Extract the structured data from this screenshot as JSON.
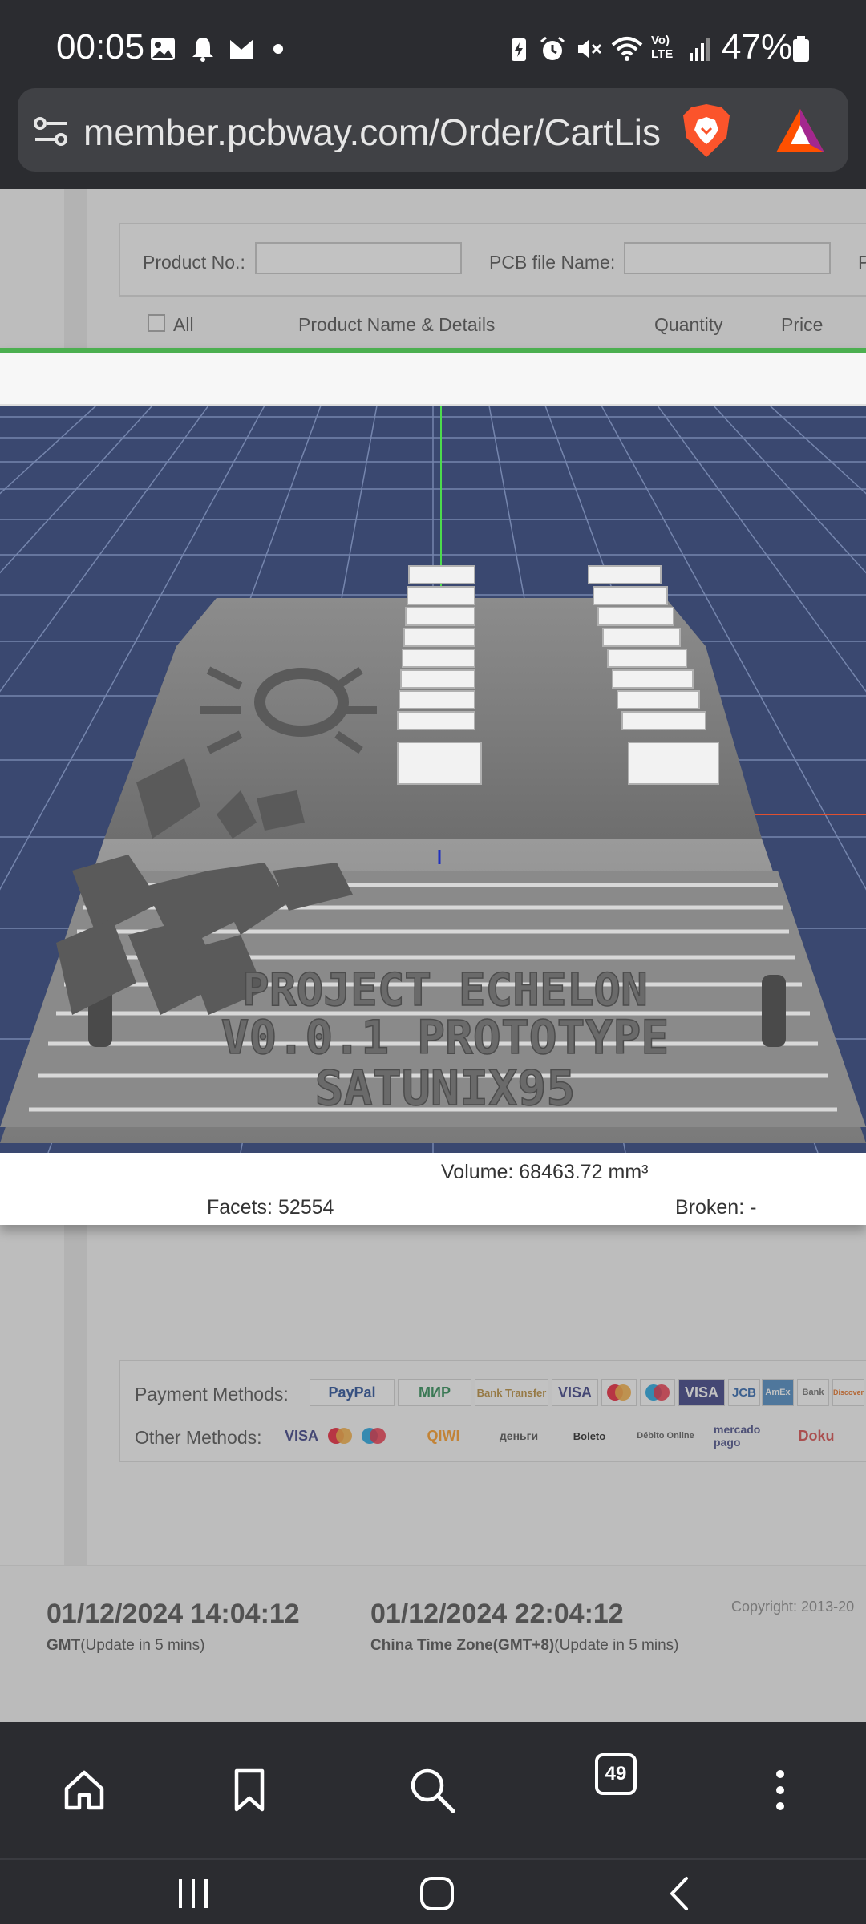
{
  "status_bar": {
    "time": "00:05",
    "battery": "47%",
    "left_icons": [
      "image-icon",
      "bell-icon",
      "mail-icon",
      "dot-icon"
    ],
    "right_icons": [
      "battery-saver-icon",
      "alarm-icon",
      "mute-icon",
      "wifi-icon",
      "volte-icon",
      "signal-icon",
      "battery-icon"
    ],
    "volte_label": "Vo) LTE"
  },
  "browser": {
    "url": "member.pcbway.com/Order/CartLis",
    "tab_count": "49"
  },
  "page": {
    "filter": {
      "product_no_label": "Product No.:",
      "pcb_file_label": "PCB file Name:",
      "extra_label": "P"
    },
    "table_header": {
      "all": "All",
      "product": "Product Name & Details",
      "quantity": "Quantity",
      "price": "Price"
    },
    "viewer": {
      "model_text": [
        "PROJECT ECHELON",
        "V0.0.1 PROTOTYPE",
        "SATUNIX95"
      ],
      "volume": "Volume:  68463.72 mm³",
      "facets": "Facets:  52554",
      "broken": "Broken:  -"
    },
    "payment": {
      "methods_label": "Payment Methods:",
      "other_label": "Other Methods:",
      "methods": [
        "PayPal",
        "МИР",
        "Bank Transfer",
        "VISA",
        "Mastercard",
        "Maestro",
        "VISA",
        "JCB",
        "AmEx",
        "Bank",
        "Discover"
      ],
      "other": [
        "VISA",
        "Mastercard",
        "Maestro",
        "QIWI",
        "деньги",
        "Boleto",
        "Débito Online",
        "mercado pago",
        "Doku"
      ]
    },
    "footer": {
      "gmt_time": "01/12/2024 14:04:12",
      "gmt_label": "GMT",
      "gmt_update": "(Update in 5 mins)",
      "china_time": "01/12/2024 22:04:12",
      "china_label": "China Time Zone(GMT+8)",
      "china_update": "(Update in 5 mins)",
      "copyright": "Copyright: 2013-20"
    }
  }
}
